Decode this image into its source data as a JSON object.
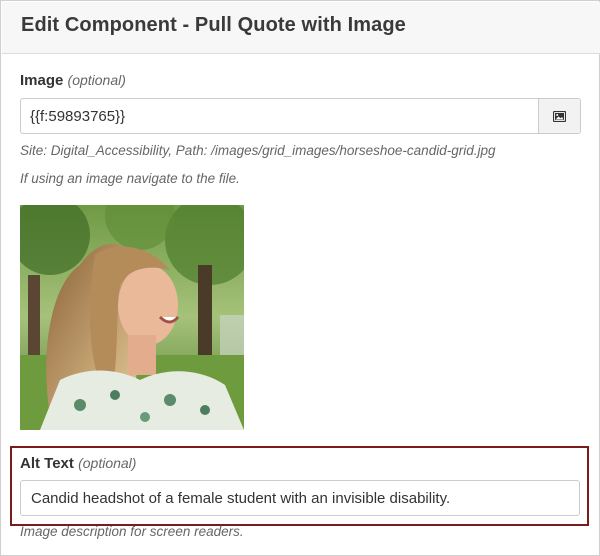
{
  "header": {
    "title": "Edit Component - Pull Quote with Image"
  },
  "image_field": {
    "label": "Image",
    "optional": "(optional)",
    "value": "{{f:59893765}}",
    "browse_icon": "image-icon",
    "site_path": "Site: Digital_Accessibility, Path: /images/grid_images/horseshoe-candid-grid.jpg",
    "hint": "If using an image navigate to the file."
  },
  "alt_field": {
    "label": "Alt Text",
    "optional": "(optional)",
    "value": "Candid headshot of a female student with an invisible disability.",
    "help": "Image description for screen readers."
  },
  "colors": {
    "highlight": "#7a1c1c",
    "header_bg": "#f7f7f7"
  }
}
